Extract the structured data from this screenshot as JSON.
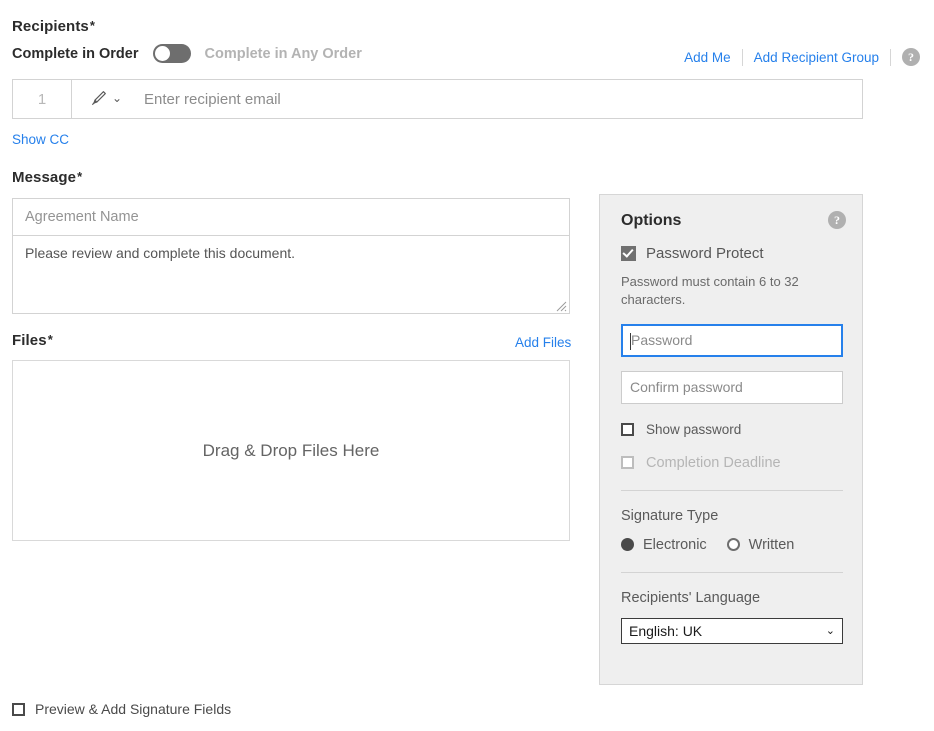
{
  "recipients": {
    "heading": "Recipients",
    "required_mark": "*",
    "order_toggle": {
      "left_label": "Complete in Order",
      "right_label": "Complete in Any Order",
      "state": "off"
    },
    "actions": {
      "add_me": "Add Me",
      "add_recipient_group": "Add Recipient Group",
      "help": "?"
    },
    "row": {
      "index": "1",
      "role_icon": "signature-pen-icon",
      "role_chevron": "⌄",
      "email_placeholder": "Enter recipient email"
    },
    "show_cc": "Show CC"
  },
  "message": {
    "heading": "Message",
    "required_mark": "*",
    "agreement_name_placeholder": "Agreement Name",
    "body_text": "Please review and complete this document."
  },
  "files": {
    "heading": "Files",
    "required_mark": "*",
    "add_files": "Add Files",
    "dropzone_text": "Drag & Drop Files Here"
  },
  "preview": {
    "label": "Preview & Add Signature Fields",
    "checked": false
  },
  "options": {
    "title": "Options",
    "help": "?",
    "password_protect": {
      "label": "Password Protect",
      "checked": true
    },
    "password_hint": "Password must contain 6 to 32 characters.",
    "password_placeholder": "Password",
    "confirm_password_placeholder": "Confirm password",
    "show_password": {
      "label": "Show password",
      "checked": false
    },
    "completion_deadline": {
      "label": "Completion Deadline",
      "checked": false,
      "disabled": true
    },
    "signature_type": {
      "title": "Signature Type",
      "electronic_label": "Electronic",
      "written_label": "Written",
      "selected": "Electronic"
    },
    "recipients_language": {
      "title": "Recipients' Language",
      "selected": "English: UK",
      "chevron": "⌄"
    }
  },
  "colors": {
    "link_blue": "#2680eb",
    "focus_blue": "#2680eb",
    "panel_bg": "#efefef",
    "toggle_track": "#6e6e6e",
    "heading_text": "#2c2c2c"
  }
}
